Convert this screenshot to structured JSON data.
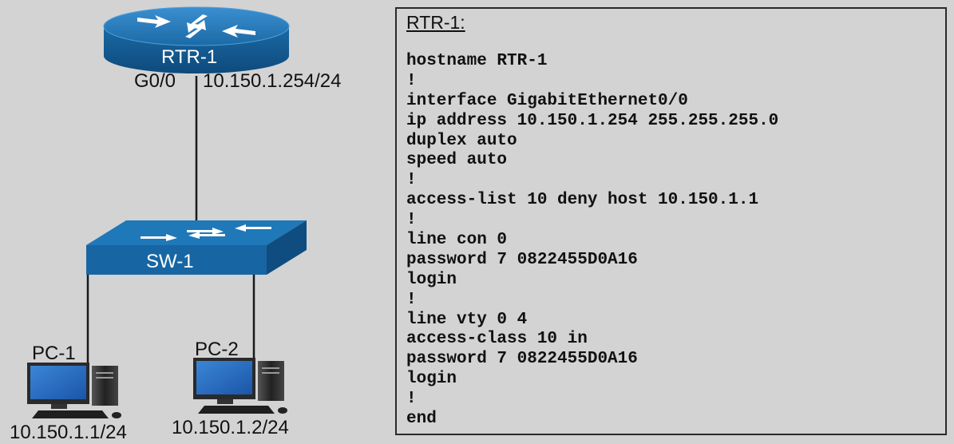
{
  "devices": {
    "router": {
      "name": "RTR-1",
      "interface": "G0/0",
      "ip": "10.150.1.254/24"
    },
    "switch": {
      "name": "SW-1"
    },
    "pc1": {
      "name": "PC-1",
      "ip": "10.150.1.1/24"
    },
    "pc2": {
      "name": "PC-2",
      "ip": "10.150.1.2/24"
    }
  },
  "config": {
    "title": "RTR-1:",
    "lines": [
      "hostname RTR-1",
      "!",
      "interface GigabitEthernet0/0",
      "ip address 10.150.1.254 255.255.255.0",
      "duplex auto",
      "speed auto",
      "!",
      "access-list 10 deny host 10.150.1.1",
      "!",
      "line con 0",
      "password 7 0822455D0A16",
      "login",
      "!",
      "line vty 0 4",
      "access-class 10 in",
      "password 7 0822455D0A16",
      "login",
      "!",
      "end"
    ]
  },
  "colors": {
    "background": "#d3d3d3",
    "device_blue": "#1e6fa8",
    "link": "#1a1a1a"
  }
}
